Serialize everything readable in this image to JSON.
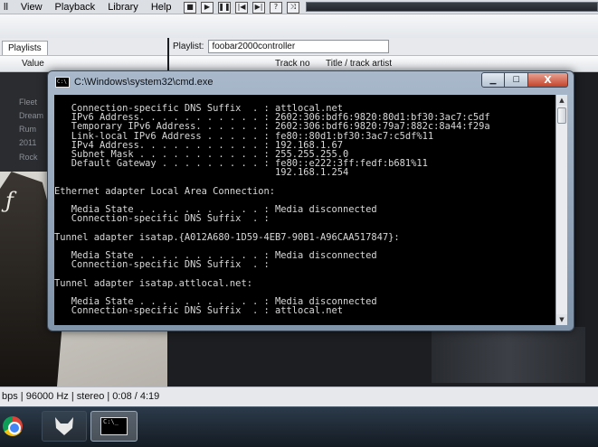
{
  "foobar": {
    "menu": [
      "ll",
      "View",
      "Playback",
      "Library",
      "Help"
    ],
    "toolbar_buttons": [
      {
        "name": "stop-icon",
        "glyph": "■"
      },
      {
        "name": "play-icon",
        "glyph": "▶"
      },
      {
        "name": "pause-icon",
        "glyph": "❚❚"
      },
      {
        "name": "previous-icon",
        "glyph": "|◀"
      },
      {
        "name": "next-icon",
        "glyph": "▶|"
      },
      {
        "name": "random-icon",
        "glyph": "?"
      },
      {
        "name": "shuffle-icon",
        "glyph": "⤨"
      }
    ],
    "left_tab": "Playlists",
    "left_column_header": "Value",
    "left_rows": [
      "Fleet",
      "Dream",
      "Rum",
      "2011",
      "Rock"
    ],
    "playlist_label": "Playlist:",
    "playlist_selected": "foobar2000controller",
    "columns": {
      "track_no": "Track no",
      "title_artist": "Title / track artist"
    },
    "status_text": "bps | 96000 Hz | stereo | 0:08 / 4:19"
  },
  "cmd": {
    "title": "C:\\Windows\\system32\\cmd.exe",
    "window_controls": {
      "minimize": "▁",
      "maximize": "☐",
      "close": "X"
    },
    "lines": [
      "   Connection-specific DNS Suffix  . : attlocal.net",
      "   IPv6 Address. . . . . . . . . . . : 2602:306:bdf6:9820:80d1:bf30:3ac7:c5df",
      "   Temporary IPv6 Address. . . . . . : 2602:306:bdf6:9820:79a7:882c:8a44:f29a",
      "   Link-local IPv6 Address . . . . . : fe80::80d1:bf30:3ac7:c5df%11",
      "   IPv4 Address. . . . . . . . . . . : 192.168.1.67",
      "   Subnet Mask . . . . . . . . . . . : 255.255.255.0",
      "   Default Gateway . . . . . . . . . : fe80::e222:3ff:fedf:b681%11",
      "                                       192.168.1.254",
      "",
      "Ethernet adapter Local Area Connection:",
      "",
      "   Media State . . . . . . . . . . . : Media disconnected",
      "   Connection-specific DNS Suffix  . :",
      "",
      "Tunnel adapter isatap.{A012A680-1D59-4EB7-90B1-A96CAA517847}:",
      "",
      "   Media State . . . . . . . . . . . : Media disconnected",
      "   Connection-specific DNS Suffix  . :",
      "",
      "Tunnel adapter isatap.attlocal.net:",
      "",
      "   Media State . . . . . . . . . . . : Media disconnected",
      "   Connection-specific DNS Suffix  . : attlocal.net"
    ]
  },
  "taskbar": {
    "cmd_icon_text": "C:\\_"
  }
}
